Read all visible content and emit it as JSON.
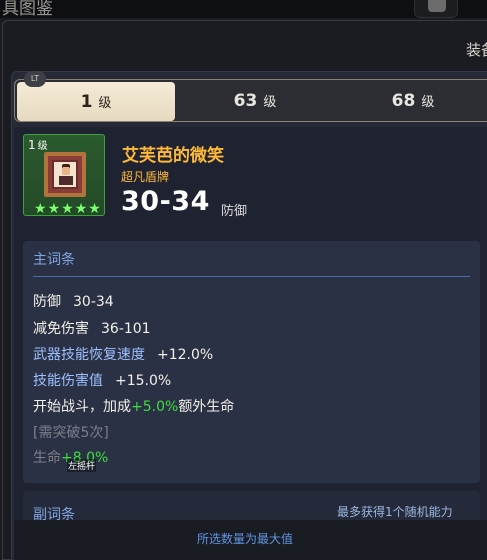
{
  "topbar": {
    "title": "具图鉴"
  },
  "panel": {
    "title": "装备"
  },
  "tabs_badge": "LT",
  "tabs": [
    {
      "value": "1",
      "unit": "级"
    },
    {
      "value": "63",
      "unit": "级"
    },
    {
      "value": "68",
      "unit": "级"
    }
  ],
  "item": {
    "level_value": "1",
    "level_unit": "级",
    "name": "艾芙芭的微笑",
    "type": "超凡盾牌",
    "stat_value": "30-34",
    "stat_label": "防御",
    "stars": 5
  },
  "main_stats": {
    "header": "主词条",
    "lines": [
      {
        "label": "防御",
        "value": "30-34"
      },
      {
        "label": "减免伤害",
        "value": "36-101"
      },
      {
        "label": "武器技能恢复速度",
        "value": "+12.0%"
      },
      {
        "label": "技能伤害值",
        "value": "+15.0%"
      }
    ],
    "special": {
      "prefix": "开始战斗，加成",
      "highlight": "+5.0%",
      "suffix": "额外生命"
    },
    "requirement": "[需突破5次]",
    "life": {
      "label": "生命",
      "value": "+8.0%"
    }
  },
  "tooltip": "左摇杆",
  "sub_stats": {
    "header": "副词条",
    "note": "最多获得1个随机能力"
  },
  "footer": {
    "text": "所选数量为最大值"
  },
  "colors": {
    "legendary": "#ffba39",
    "stat_blue": "#9cc0ff",
    "bonus_green": "#3cdf3c",
    "header_blue": "#7fa6e4"
  }
}
